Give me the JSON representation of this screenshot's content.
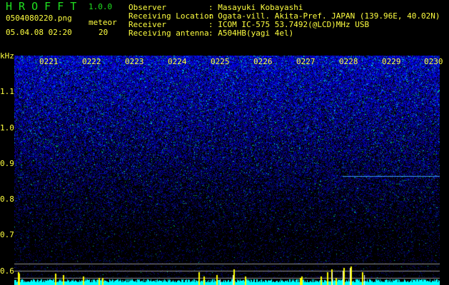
{
  "header": {
    "app_title": "H R O F F T",
    "version": "1.0.0",
    "filename": "0504080220.png",
    "datetime": "05.04.08 02:20",
    "meteor_label": "meteor",
    "meteor_count": "20"
  },
  "info": [
    {
      "label": "Observer",
      "value": ": Masayuki Kobayashi"
    },
    {
      "label": "Receiving Location",
      "value": ": Ogata-vill. Akita-Pref. JAPAN (139.96E, 40.02N)"
    },
    {
      "label": "Receiver",
      "value": ": ICOM IC-575 53.7492(@LCD)MHz USB"
    },
    {
      "label": "Receiving antenna",
      "value": ": A504HB(yagi 4el)"
    }
  ],
  "axis": {
    "unit": "kHz",
    "y_ticks": [
      "1.1",
      "1.0",
      "0.9",
      "0.8",
      "0.7",
      "0.6"
    ],
    "time_ticks": [
      "0221",
      "0222",
      "0223",
      "0224",
      "0225",
      "0226",
      "0227",
      "0228",
      "0229",
      "0230"
    ]
  },
  "colors": {
    "text": "#ffff40",
    "title": "#20e020",
    "noise": "#2020c0",
    "histogram": "#00ffff",
    "spike": "#ffff00"
  }
}
